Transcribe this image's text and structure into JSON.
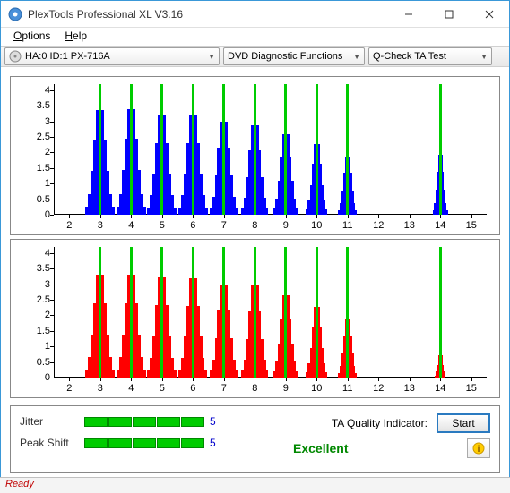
{
  "window": {
    "title": "PlexTools Professional XL V3.16"
  },
  "menu": {
    "options": "Options",
    "help": "Help"
  },
  "toolbar": {
    "drive": "HA:0 ID:1   PX-716A",
    "mode": "DVD Diagnostic Functions",
    "test": "Q-Check TA Test"
  },
  "chart_data": [
    {
      "type": "bar",
      "color": "blue",
      "xlim": [
        1.5,
        15.5
      ],
      "ylim": [
        0,
        4.2
      ],
      "xticks": [
        2,
        3,
        4,
        5,
        6,
        7,
        8,
        9,
        10,
        11,
        12,
        13,
        14,
        15
      ],
      "yticks": [
        0,
        0.5,
        1,
        1.5,
        2,
        2.5,
        3,
        3.5,
        4
      ],
      "peaks": [
        {
          "center": 3,
          "height": 3.75,
          "width": 0.85
        },
        {
          "center": 4,
          "height": 3.8,
          "width": 0.85
        },
        {
          "center": 5,
          "height": 3.55,
          "width": 0.85
        },
        {
          "center": 6,
          "height": 3.55,
          "width": 0.85
        },
        {
          "center": 7,
          "height": 3.35,
          "width": 0.82
        },
        {
          "center": 8,
          "height": 3.2,
          "width": 0.78
        },
        {
          "center": 9,
          "height": 2.9,
          "width": 0.72
        },
        {
          "center": 10,
          "height": 2.55,
          "width": 0.62
        },
        {
          "center": 11,
          "height": 2.1,
          "width": 0.55
        },
        {
          "center": 14,
          "height": 2.15,
          "width": 0.45
        }
      ]
    },
    {
      "type": "bar",
      "color": "red",
      "xlim": [
        1.5,
        15.5
      ],
      "ylim": [
        0,
        4.2
      ],
      "xticks": [
        2,
        3,
        4,
        5,
        6,
        7,
        8,
        9,
        10,
        11,
        12,
        13,
        14,
        15
      ],
      "yticks": [
        0,
        0.5,
        1,
        1.5,
        2,
        2.5,
        3,
        3.5,
        4
      ],
      "peaks": [
        {
          "center": 3,
          "height": 3.7,
          "width": 0.85
        },
        {
          "center": 4,
          "height": 3.7,
          "width": 0.85
        },
        {
          "center": 5,
          "height": 3.6,
          "width": 0.85
        },
        {
          "center": 6,
          "height": 3.55,
          "width": 0.83
        },
        {
          "center": 7,
          "height": 3.35,
          "width": 0.82
        },
        {
          "center": 8,
          "height": 3.3,
          "width": 0.78
        },
        {
          "center": 9,
          "height": 2.95,
          "width": 0.72
        },
        {
          "center": 10,
          "height": 2.55,
          "width": 0.62
        },
        {
          "center": 11,
          "height": 2.1,
          "width": 0.55
        },
        {
          "center": 14,
          "height": 1.1,
          "width": 0.3
        }
      ]
    }
  ],
  "metrics": {
    "jitter_label": "Jitter",
    "jitter_value": "5",
    "peakshift_label": "Peak Shift",
    "peakshift_value": "5",
    "ta_label": "TA Quality Indicator:",
    "ta_value": "Excellent",
    "start": "Start"
  },
  "status": "Ready"
}
